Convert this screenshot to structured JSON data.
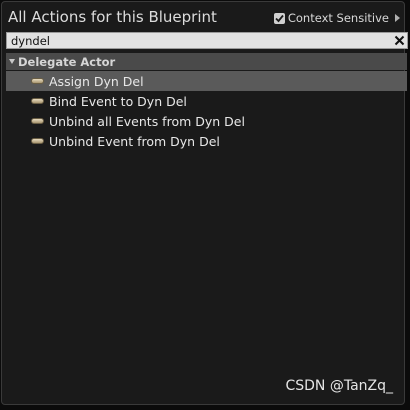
{
  "window": {
    "title": "All Actions for this Blueprint",
    "context_sensitive_label": "Context Sensitive",
    "context_sensitive_checked": true
  },
  "search": {
    "value": "dyndel",
    "clear_icon": "close-icon"
  },
  "category": {
    "label": "Delegate Actor",
    "expanded": true
  },
  "actions": [
    {
      "label": "Assign Dyn Del",
      "selected": true,
      "icon": "function-pill-icon"
    },
    {
      "label": "Bind Event to Dyn Del",
      "selected": false,
      "icon": "function-pill-icon"
    },
    {
      "label": "Unbind all Events from Dyn Del",
      "selected": false,
      "icon": "function-pill-icon"
    },
    {
      "label": "Unbind Event from Dyn Del",
      "selected": false,
      "icon": "function-pill-icon"
    }
  ],
  "watermark": "CSDN @TanZq_",
  "colors": {
    "panel_bg": "#1a1a1a",
    "category_bg": "#4a4a4a",
    "selected_bg": "#5a5a5a",
    "search_bg": "#e2e2e2"
  }
}
